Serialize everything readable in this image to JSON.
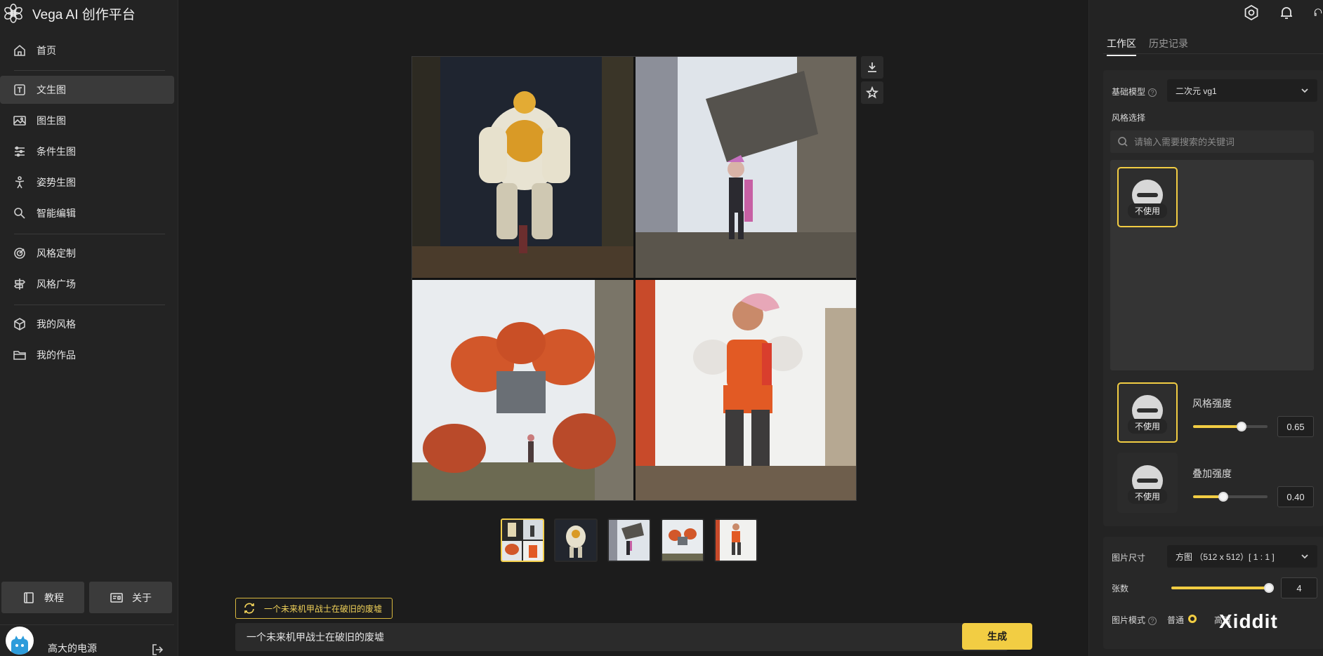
{
  "brand": {
    "title": "Vega AI 创作平台"
  },
  "sidebar": {
    "items": [
      {
        "label": "首页",
        "icon": "home-icon"
      },
      {
        "label": "文生图",
        "icon": "text-icon"
      },
      {
        "label": "图生图",
        "icon": "image-icon"
      },
      {
        "label": "条件生图",
        "icon": "sliders-icon"
      },
      {
        "label": "姿势生图",
        "icon": "pose-icon"
      },
      {
        "label": "智能编辑",
        "icon": "edit-icon"
      },
      {
        "label": "风格定制",
        "icon": "target-icon"
      },
      {
        "label": "风格广场",
        "icon": "signpost-icon"
      },
      {
        "label": "我的风格",
        "icon": "box-icon"
      },
      {
        "label": "我的作品",
        "icon": "folder-icon"
      }
    ],
    "tutorial_label": "教程",
    "about_label": "关于",
    "user_name": "高大的电源"
  },
  "main": {
    "prompt_chip": "一个未来机甲战士在破旧的废墟",
    "prompt_value": "一个未来机甲战士在破旧的废墟",
    "generate_label": "生成"
  },
  "right": {
    "tabs": [
      "工作区",
      "历史记录"
    ],
    "base_model_label": "基础模型",
    "base_model_value": "二次元 vg1",
    "style_select_label": "风格选择",
    "search_placeholder": "请输入需要搜索的关键词",
    "no_use_label": "不使用",
    "style_strength_label": "风格强度",
    "style_strength_value": "0.65",
    "overlay_strength_label": "叠加强度",
    "overlay_strength_value": "0.40",
    "image_size_label": "图片尺寸",
    "image_size_value": "方图 （512 x 512）[ 1 : 1 ]",
    "count_label": "张数",
    "count_value": "4",
    "image_mode_label": "图片模式",
    "mode_normal": "普通",
    "mode_hd": "高清"
  },
  "watermark": "Xiddit",
  "colors": {
    "accent": "#f2cd43",
    "sidebar_bg": "#232323",
    "main_bg": "#1c1c1c"
  }
}
